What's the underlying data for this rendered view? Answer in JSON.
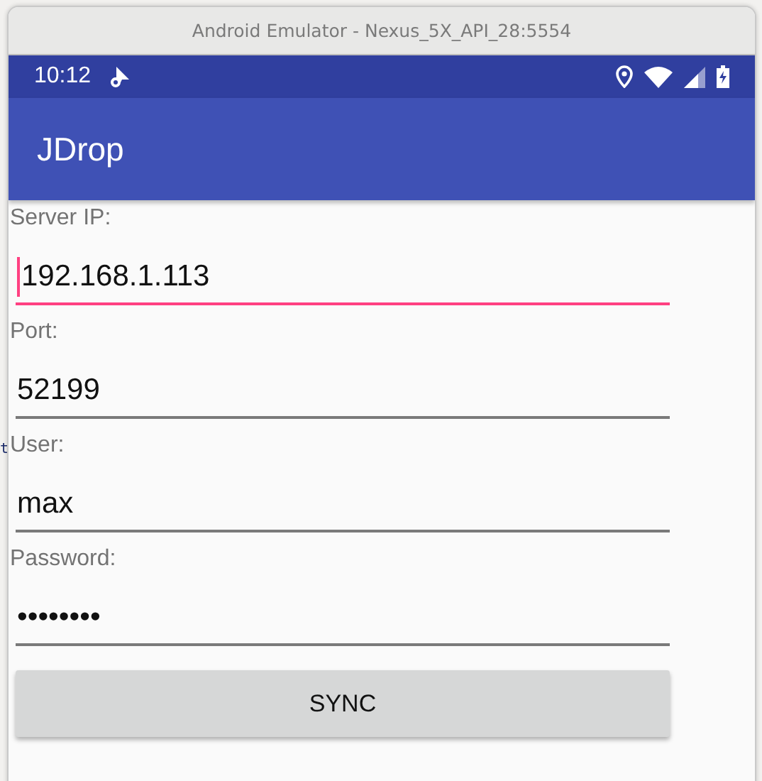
{
  "window": {
    "title": "Android Emulator - Nexus_5X_API_28:5554"
  },
  "background_fragment": "t",
  "status_bar": {
    "time": "10:12"
  },
  "app_bar": {
    "title": "JDrop"
  },
  "fields": [
    {
      "label": "Server IP:",
      "value": "192.168.1.113",
      "focused": true
    },
    {
      "label": "Port:",
      "value": "52199",
      "focused": false
    },
    {
      "label": "User:",
      "value": "max",
      "focused": false
    },
    {
      "label": "Password:",
      "value": "••••••••",
      "focused": false
    }
  ],
  "button": {
    "label": "SYNC"
  }
}
